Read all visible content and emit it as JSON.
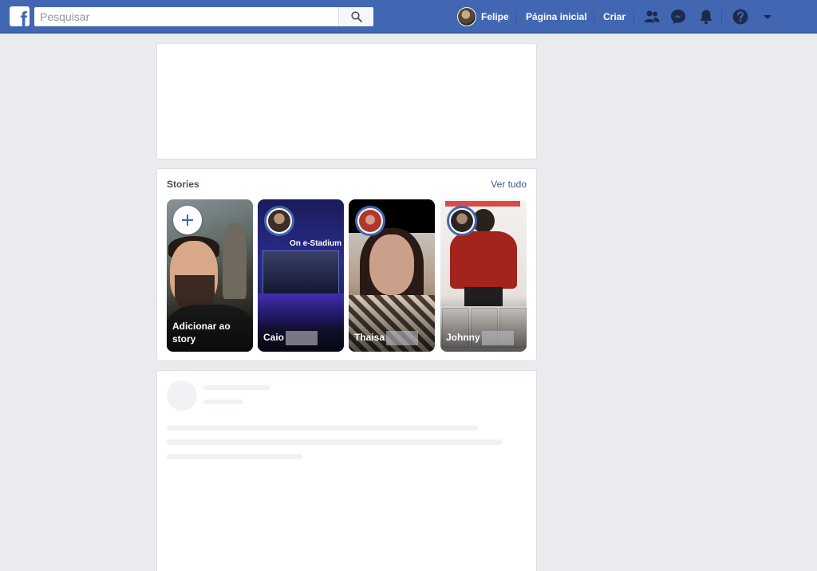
{
  "header": {
    "logo_letter": "f",
    "search": {
      "placeholder": "Pesquisar"
    },
    "user_name": "Felipe",
    "home_label": "Página inicial",
    "create_label": "Criar"
  },
  "stories": {
    "title": "Stories",
    "see_all": "Ver tudo",
    "items": [
      {
        "label": "Adicionar ao story"
      },
      {
        "label": "Caio",
        "overlay_text": "On e-Stadium"
      },
      {
        "label": "Thaisa"
      },
      {
        "label": "Johnny"
      }
    ]
  },
  "colors": {
    "brand": "#4267b2",
    "background": "#e9ebee",
    "link": "#385898"
  }
}
